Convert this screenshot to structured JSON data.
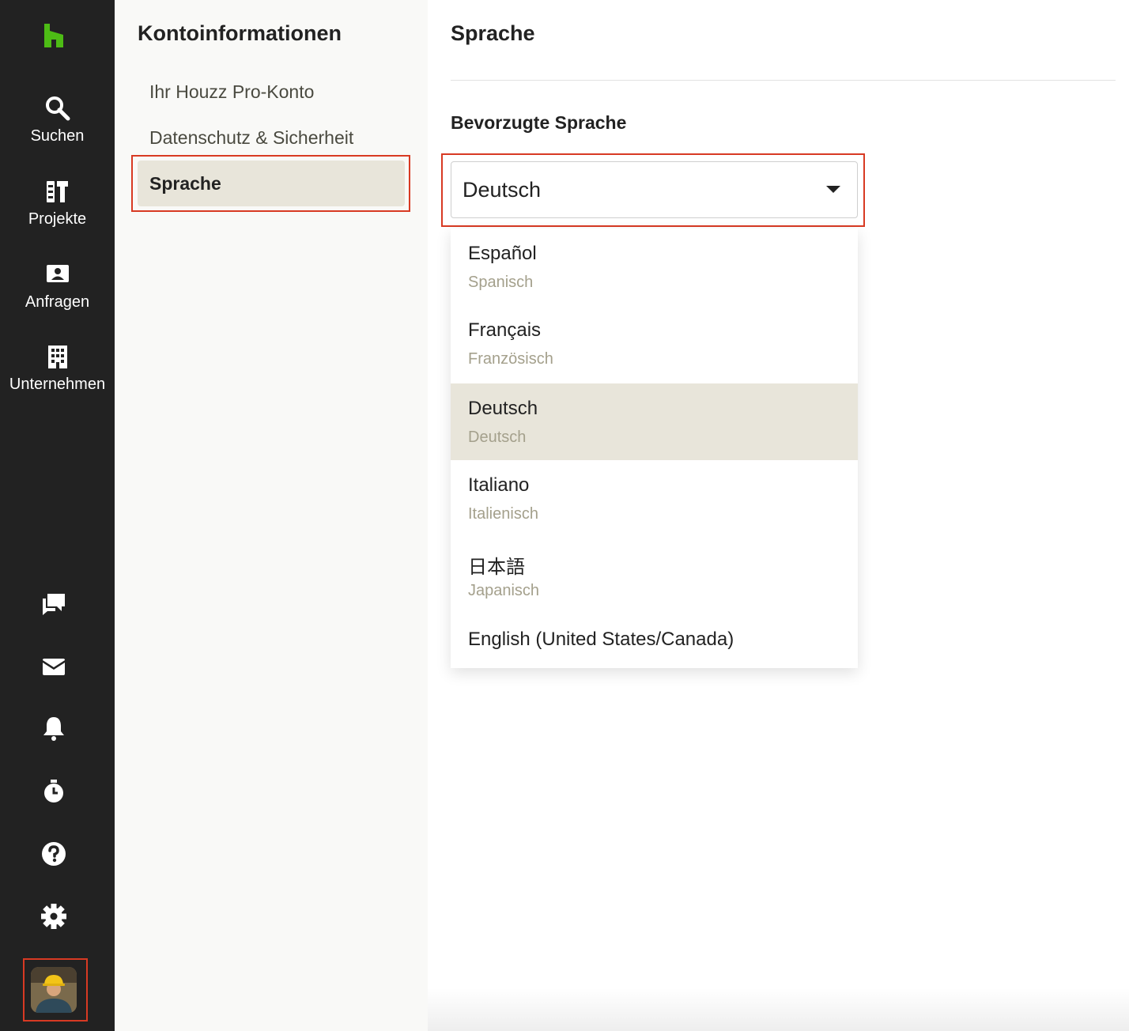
{
  "rail": {
    "brand_color": "#4dbc15",
    "items": [
      {
        "label": "Suchen",
        "icon": "search-icon"
      },
      {
        "label": "Projekte",
        "icon": "projects-icon"
      },
      {
        "label": "Anfragen",
        "icon": "inquiries-icon"
      },
      {
        "label": "Unternehmen",
        "icon": "business-icon"
      }
    ],
    "bottom_icons": [
      "messages-icon",
      "inbox-icon",
      "bell-icon",
      "timer-icon",
      "help-icon",
      "gear-icon"
    ]
  },
  "subnav": {
    "title": "Kontoinformationen",
    "items": [
      {
        "label": "Ihr Houzz Pro-Konto"
      },
      {
        "label": "Datenschutz & Sicherheit"
      },
      {
        "label": "Sprache",
        "active": true
      }
    ]
  },
  "main": {
    "title": "Sprache",
    "field_label": "Bevorzugte Sprache",
    "select_value": "Deutsch",
    "options": [
      {
        "label": "Español",
        "sub": "Spanisch"
      },
      {
        "label": "Français",
        "sub": "Französisch"
      },
      {
        "label": "Deutsch",
        "sub": "Deutsch",
        "selected": true
      },
      {
        "label": "Italiano",
        "sub": "Italienisch"
      },
      {
        "label": "日本語",
        "sub": "Japanisch"
      },
      {
        "label": "English (United States/Canada)",
        "sub": ""
      }
    ]
  },
  "colors": {
    "highlight": "#d83a23",
    "rail_bg": "#222222",
    "selected_bg": "#e8e5da"
  }
}
